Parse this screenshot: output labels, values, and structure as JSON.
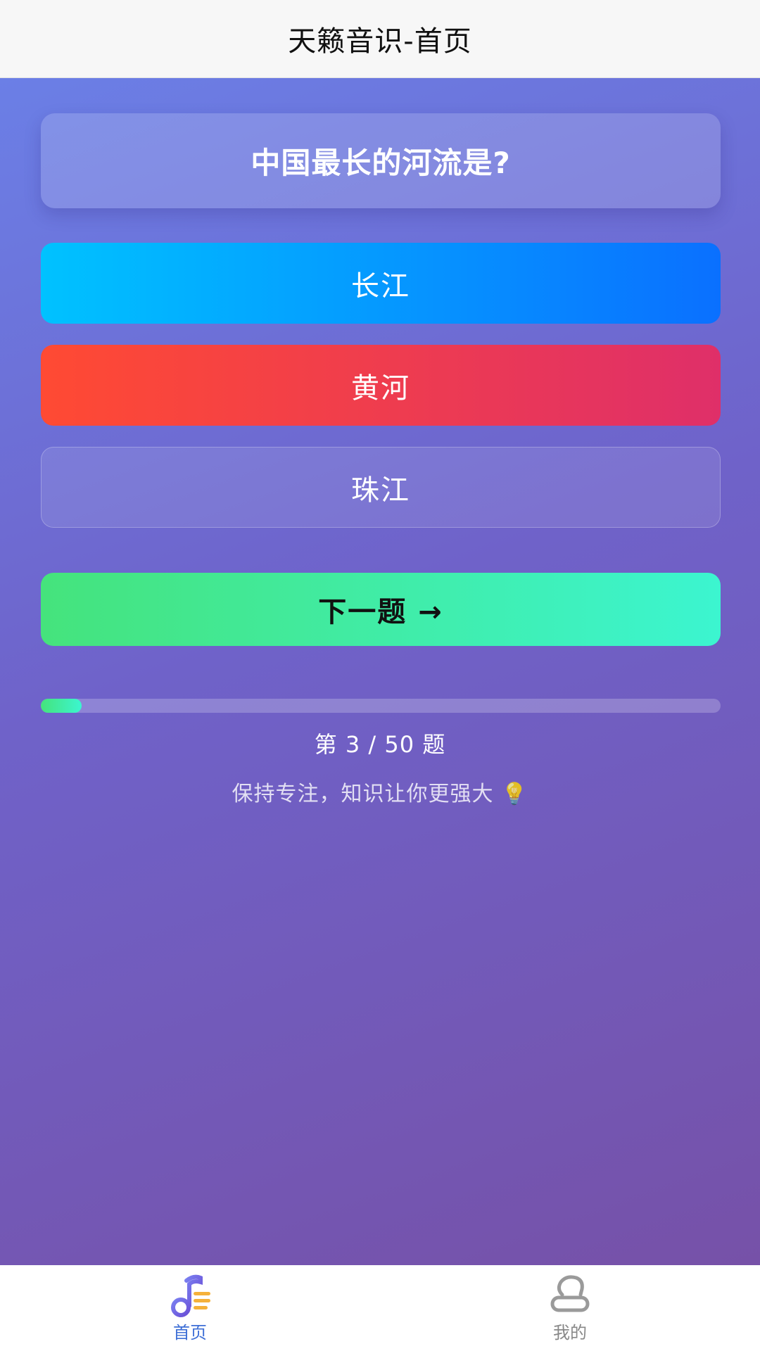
{
  "header": {
    "title": "天籁音识-首页"
  },
  "quiz": {
    "question": "中国最长的河流是?",
    "options": [
      {
        "label": "长江"
      },
      {
        "label": "黄河"
      },
      {
        "label": "珠江"
      }
    ],
    "next_label": "下一题 →",
    "progress": {
      "current": 3,
      "total": 50,
      "text": "第 3 / 50 题"
    },
    "motto": "保持专注，知识让你更强大 💡"
  },
  "tabbar": {
    "items": [
      {
        "label": "首页",
        "icon": "music-note-icon",
        "active": true
      },
      {
        "label": "我的",
        "icon": "profile-icon",
        "active": false
      }
    ]
  },
  "colors": {
    "accent_active_tab": "#3e6fd6",
    "option_1": "#0a70ff",
    "option_2": "#ff4a33",
    "next_button": "#45e37c"
  }
}
